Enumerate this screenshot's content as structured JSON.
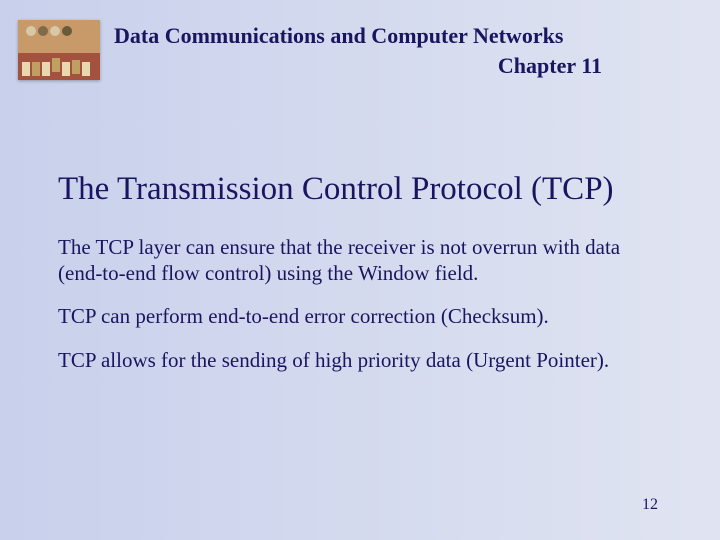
{
  "header": {
    "title": "Data Communications and Computer Networks",
    "chapter": "Chapter 11"
  },
  "slide": {
    "title": "The Transmission Control Protocol (TCP)",
    "paragraphs": [
      "The TCP layer can ensure that the receiver is not overrun with data (end-to-end flow control) using the Window field.",
      "TCP can perform end-to-end error correction (Checksum).",
      "TCP allows for the sending of high priority data (Urgent Pointer)."
    ]
  },
  "page_number": "12"
}
